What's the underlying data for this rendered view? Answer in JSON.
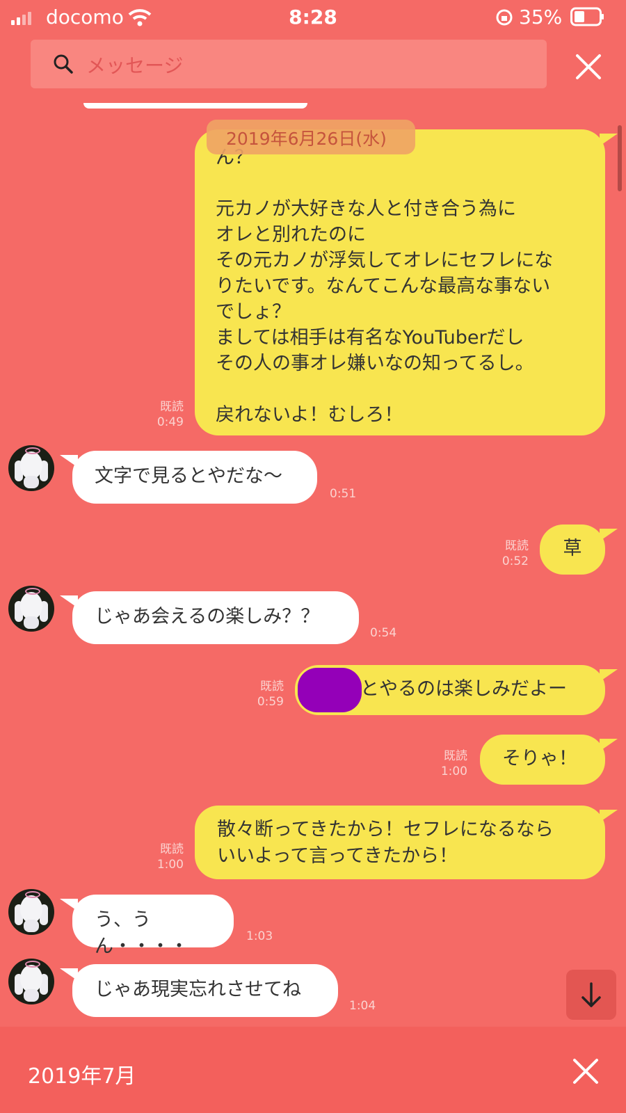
{
  "status_bar": {
    "carrier": "docomo",
    "time": "8:28",
    "battery": "35%"
  },
  "search": {
    "placeholder": "メッセージ"
  },
  "date_pill": "2019年6月26日(水)",
  "messages": [
    {
      "side": "me",
      "read": "既読",
      "time": "0:49",
      "lines": [
        "ん？",
        "",
        "元カノが大好きな人と付き合う為に",
        "オレと別れたのに",
        "その元カノが浮気してオレにセフレにな",
        "りたいです。なんてこんな最高な事ない",
        "でしょ？",
        "ましては相手は有名なYouTuberだし",
        "その人の事オレ嫌いなの知ってるし。",
        "",
        "戻れないよ！むしろ！"
      ]
    },
    {
      "side": "them",
      "time": "0:51",
      "text": "文字で見るとやだな〜"
    },
    {
      "side": "me",
      "read": "既読",
      "time": "0:52",
      "text": "草"
    },
    {
      "side": "them",
      "time": "0:54",
      "text": "じゃあ会えるの楽しみ？？"
    },
    {
      "side": "me",
      "read": "既読",
      "time": "0:59",
      "text": "とやるのは楽しみだよー"
    },
    {
      "side": "me",
      "read": "既読",
      "time": "1:00",
      "text": "そりゃ！"
    },
    {
      "side": "me",
      "read": "既読",
      "time": "1:00",
      "lines": [
        "散々断ってきたから！セフレになるなら",
        "いいよって言ってきたから！"
      ]
    },
    {
      "side": "them",
      "time": "1:03",
      "text": "う、うん・・・・"
    },
    {
      "side": "them",
      "time": "1:04",
      "text": "じゃあ現実忘れさせてね"
    }
  ],
  "bottom_bar": {
    "label": "2019年7月"
  },
  "icons": {
    "search": "search-icon",
    "close": "close-icon",
    "down": "arrow-down-icon",
    "wifi": "wifi-icon",
    "battery": "battery-icon",
    "rotation_lock": "rotation-lock-icon"
  }
}
